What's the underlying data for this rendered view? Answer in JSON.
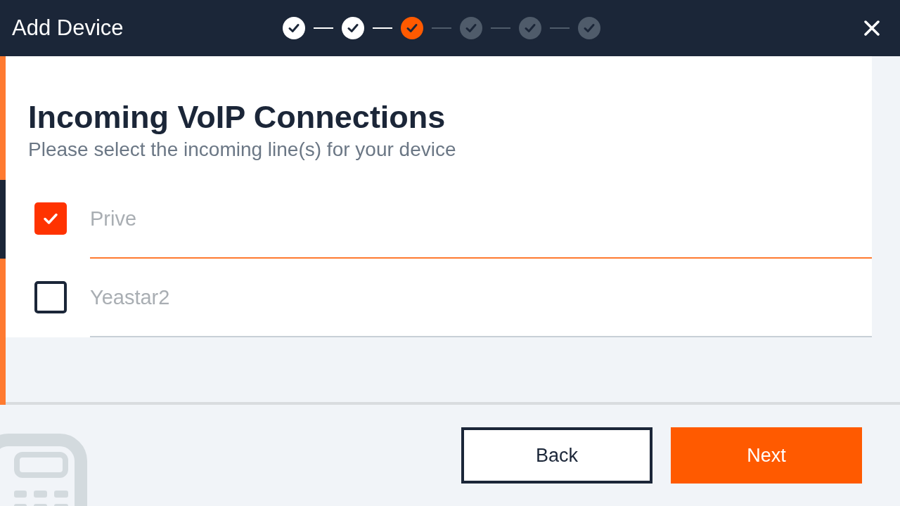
{
  "header": {
    "title": "Add Device",
    "steps": [
      {
        "completed": true,
        "selected": false
      },
      {
        "completed": true,
        "selected": false
      },
      {
        "completed": false,
        "selected": true
      },
      {
        "completed": false,
        "selected": false
      },
      {
        "completed": false,
        "selected": false
      },
      {
        "completed": false,
        "selected": false
      }
    ]
  },
  "page": {
    "title": "Incoming VoIP Connections",
    "subtitle": "Please select the incoming line(s) for your device"
  },
  "lines": [
    {
      "label": "Prive",
      "checked": true
    },
    {
      "label": "Yeastar2",
      "checked": false
    }
  ],
  "footer": {
    "buttons": [
      {
        "label": "Back",
        "kind": "secondary"
      },
      {
        "label": "Next",
        "kind": "primary"
      }
    ]
  }
}
